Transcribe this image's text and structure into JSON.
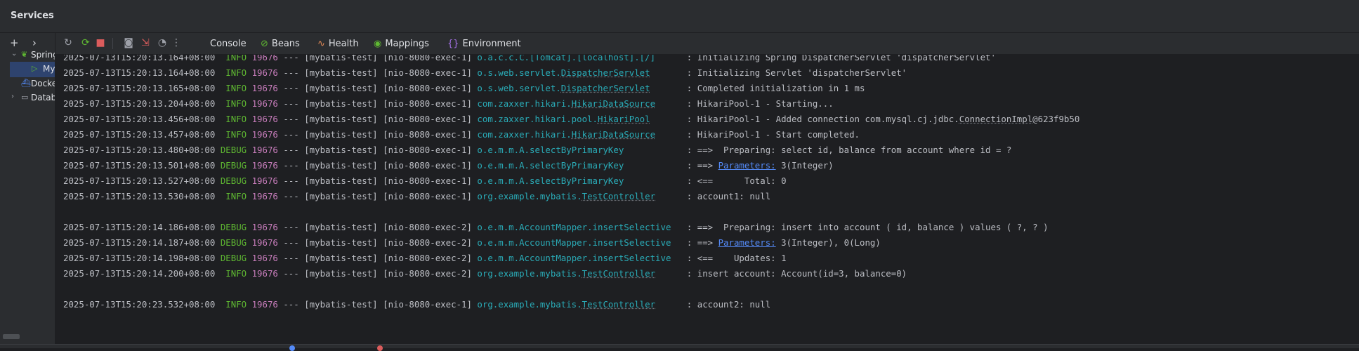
{
  "window": {
    "title": "Services"
  },
  "left_panel": {
    "tools": [
      {
        "icon": "add-icon",
        "glyph": "+"
      },
      {
        "icon": "chevron-right-icon",
        "glyph": "›"
      }
    ],
    "tree": [
      {
        "label": "Spring Boot",
        "icon": "spring-boot-icon",
        "expanded": true
      },
      {
        "label": "MybatisTestApplication",
        "icon": "run-icon",
        "selected": true
      },
      {
        "label": "Docker",
        "icon": "docker-icon"
      },
      {
        "label": "Database",
        "icon": "folder-icon",
        "expanded": false
      }
    ]
  },
  "toolbar": {
    "actions": [
      {
        "name": "rerun-icon",
        "glyph": "↻",
        "color": "#9da0a8"
      },
      {
        "name": "restart-icon",
        "glyph": "⟳",
        "color": "#5fb832"
      },
      {
        "name": "stop-icon",
        "glyph": "■",
        "color": "#db5c5c"
      },
      {
        "name": "camera-icon",
        "glyph": "◙",
        "color": "#9da0a8"
      },
      {
        "name": "exit-icon",
        "glyph": "⇲",
        "color": "#db5c5c"
      },
      {
        "name": "gauge-icon",
        "glyph": "◔",
        "color": "#9da0a8"
      },
      {
        "name": "more-icon",
        "glyph": "⋮",
        "color": "#9da0a8"
      }
    ],
    "tabs": [
      {
        "label": "Console",
        "icon": "",
        "icon_color": ""
      },
      {
        "label": "Beans",
        "icon": "⊘",
        "icon_color": "#5fb832"
      },
      {
        "label": "Health",
        "icon": "∿",
        "icon_color": "#e08855"
      },
      {
        "label": "Mappings",
        "icon": "◉",
        "icon_color": "#5fb832"
      },
      {
        "label": "Environment",
        "icon": "{}",
        "icon_color": "#a571e6"
      }
    ]
  },
  "colors": {
    "background": "#1e1f22",
    "panel": "#2b2d30",
    "level": "#5fb832",
    "pid": "#c77dbb",
    "logger": "#2aacb8",
    "link": "#548af7",
    "selection": "#2e436e"
  },
  "log_lines": [
    {
      "ts": "2025-07-13T15:20:13.164+08:00",
      "level": "INFO",
      "pid": "19676",
      "app": "[mybatis-test]",
      "thread": "[nio-8080-exec-1]",
      "logger_pkg": "o.a.c.c.C.[Tomcat].[localhost].[/]",
      "logger_cls": "",
      "msg_pre": "Initializing Spring DispatcherServlet 'dispatcherServlet'",
      "msg_link": "",
      "msg_ul": "",
      "msg_post": ""
    },
    {
      "ts": "2025-07-13T15:20:13.164+08:00",
      "level": "INFO",
      "pid": "19676",
      "app": "[mybatis-test]",
      "thread": "[nio-8080-exec-1]",
      "logger_pkg": "o.s.web.servlet.",
      "logger_cls": "DispatcherServlet",
      "msg_pre": "Initializing Servlet 'dispatcherServlet'",
      "msg_link": "",
      "msg_ul": "",
      "msg_post": ""
    },
    {
      "ts": "2025-07-13T15:20:13.165+08:00",
      "level": "INFO",
      "pid": "19676",
      "app": "[mybatis-test]",
      "thread": "[nio-8080-exec-1]",
      "logger_pkg": "o.s.web.servlet.",
      "logger_cls": "DispatcherServlet",
      "msg_pre": "Completed initialization in 1 ms",
      "msg_link": "",
      "msg_ul": "",
      "msg_post": ""
    },
    {
      "ts": "2025-07-13T15:20:13.204+08:00",
      "level": "INFO",
      "pid": "19676",
      "app": "[mybatis-test]",
      "thread": "[nio-8080-exec-1]",
      "logger_pkg": "com.zaxxer.hikari.",
      "logger_cls": "HikariDataSource",
      "msg_pre": "HikariPool-1 - Starting...",
      "msg_link": "",
      "msg_ul": "",
      "msg_post": ""
    },
    {
      "ts": "2025-07-13T15:20:13.456+08:00",
      "level": "INFO",
      "pid": "19676",
      "app": "[mybatis-test]",
      "thread": "[nio-8080-exec-1]",
      "logger_pkg": "com.zaxxer.hikari.pool.",
      "logger_cls": "HikariPool",
      "msg_pre": "HikariPool-1 - Added connection com.mysql.cj.jdbc.",
      "msg_link": "",
      "msg_ul": "ConnectionImpl",
      "msg_post": "@623f9b50"
    },
    {
      "ts": "2025-07-13T15:20:13.457+08:00",
      "level": "INFO",
      "pid": "19676",
      "app": "[mybatis-test]",
      "thread": "[nio-8080-exec-1]",
      "logger_pkg": "com.zaxxer.hikari.",
      "logger_cls": "HikariDataSource",
      "msg_pre": "HikariPool-1 - Start completed.",
      "msg_link": "",
      "msg_ul": "",
      "msg_post": ""
    },
    {
      "ts": "2025-07-13T15:20:13.480+08:00",
      "level": "DEBUG",
      "pid": "19676",
      "app": "[mybatis-test]",
      "thread": "[nio-8080-exec-1]",
      "logger_pkg": "o.e.m.m.A.selectByPrimaryKey",
      "logger_cls": "",
      "msg_pre": "==>  Preparing: select id, balance from account where id = ?",
      "msg_link": "",
      "msg_ul": "",
      "msg_post": ""
    },
    {
      "ts": "2025-07-13T15:20:13.501+08:00",
      "level": "DEBUG",
      "pid": "19676",
      "app": "[mybatis-test]",
      "thread": "[nio-8080-exec-1]",
      "logger_pkg": "o.e.m.m.A.selectByPrimaryKey",
      "logger_cls": "",
      "msg_pre": "==> ",
      "msg_link": "Parameters:",
      "msg_ul": "",
      "msg_post": " 3(Integer)"
    },
    {
      "ts": "2025-07-13T15:20:13.527+08:00",
      "level": "DEBUG",
      "pid": "19676",
      "app": "[mybatis-test]",
      "thread": "[nio-8080-exec-1]",
      "logger_pkg": "o.e.m.m.A.selectByPrimaryKey",
      "logger_cls": "",
      "msg_pre": "<==      Total: 0",
      "msg_link": "",
      "msg_ul": "",
      "msg_post": ""
    },
    {
      "ts": "2025-07-13T15:20:13.530+08:00",
      "level": "INFO",
      "pid": "19676",
      "app": "[mybatis-test]",
      "thread": "[nio-8080-exec-1]",
      "logger_pkg": "org.example.mybatis.",
      "logger_cls": "TestController",
      "msg_pre": "account1: null",
      "msg_link": "",
      "msg_ul": "",
      "msg_post": ""
    },
    {
      "blank": true
    },
    {
      "ts": "2025-07-13T15:20:14.186+08:00",
      "level": "DEBUG",
      "pid": "19676",
      "app": "[mybatis-test]",
      "thread": "[nio-8080-exec-2]",
      "logger_pkg": "o.e.m.m.AccountMapper.insertSelective",
      "logger_cls": "",
      "msg_pre": "==>  Preparing: insert into account ( id, balance ) values ( ?, ? )",
      "msg_link": "",
      "msg_ul": "",
      "msg_post": ""
    },
    {
      "ts": "2025-07-13T15:20:14.187+08:00",
      "level": "DEBUG",
      "pid": "19676",
      "app": "[mybatis-test]",
      "thread": "[nio-8080-exec-2]",
      "logger_pkg": "o.e.m.m.AccountMapper.insertSelective",
      "logger_cls": "",
      "msg_pre": "==> ",
      "msg_link": "Parameters:",
      "msg_ul": "",
      "msg_post": " 3(Integer), 0(Long)"
    },
    {
      "ts": "2025-07-13T15:20:14.198+08:00",
      "level": "DEBUG",
      "pid": "19676",
      "app": "[mybatis-test]",
      "thread": "[nio-8080-exec-2]",
      "logger_pkg": "o.e.m.m.AccountMapper.insertSelective",
      "logger_cls": "",
      "msg_pre": "<==    Updates: 1",
      "msg_link": "",
      "msg_ul": "",
      "msg_post": ""
    },
    {
      "ts": "2025-07-13T15:20:14.200+08:00",
      "level": "INFO",
      "pid": "19676",
      "app": "[mybatis-test]",
      "thread": "[nio-8080-exec-2]",
      "logger_pkg": "org.example.mybatis.",
      "logger_cls": "TestController",
      "msg_pre": "insert account: Account(id=3, balance=0)",
      "msg_link": "",
      "msg_ul": "",
      "msg_post": ""
    },
    {
      "blank": true
    },
    {
      "ts": "2025-07-13T15:20:23.532+08:00",
      "level": "INFO",
      "pid": "19676",
      "app": "[mybatis-test]",
      "thread": "[nio-8080-exec-1]",
      "logger_pkg": "org.example.mybatis.",
      "logger_cls": "TestController",
      "msg_pre": "account2: null",
      "msg_link": "",
      "msg_ul": "",
      "msg_post": ""
    }
  ]
}
